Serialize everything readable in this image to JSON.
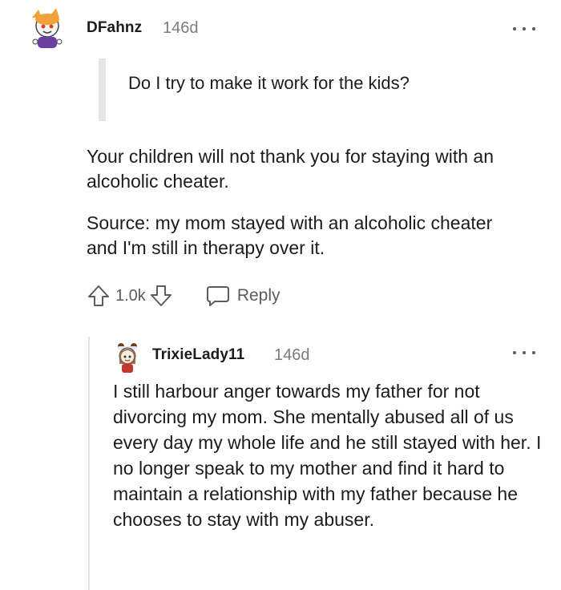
{
  "comment": {
    "username": "DFahnz",
    "age": "146d",
    "quote": "Do I try to make it work for the kids?",
    "paragraphs": [
      "Your children will not thank you for staying with an alcoholic cheater.",
      "Source: my mom stayed with an alcoholic cheater and I'm still in therapy over it."
    ],
    "vote_count": "1.0k",
    "reply_label": "Reply"
  },
  "reply": {
    "username": "TrixieLady11",
    "age": "146d",
    "body": "I still harbour anger towards my father for not divorcing my mom. She mentally abused all of us every day my whole life and he still stayed with her. I no longer speak to my mother and find it hard to maintain a relationship with my father because he chooses to stay with my abuser."
  },
  "colors": {
    "text": "#1c1c1c",
    "meta": "#7c7c7c",
    "action": "#5c5c5c",
    "quote_bar": "#e6e6e6",
    "thread_line": "#e3e3e3"
  },
  "icons": [
    "upvote-icon",
    "downvote-icon",
    "reply-bubble-icon",
    "more-options-icon"
  ]
}
